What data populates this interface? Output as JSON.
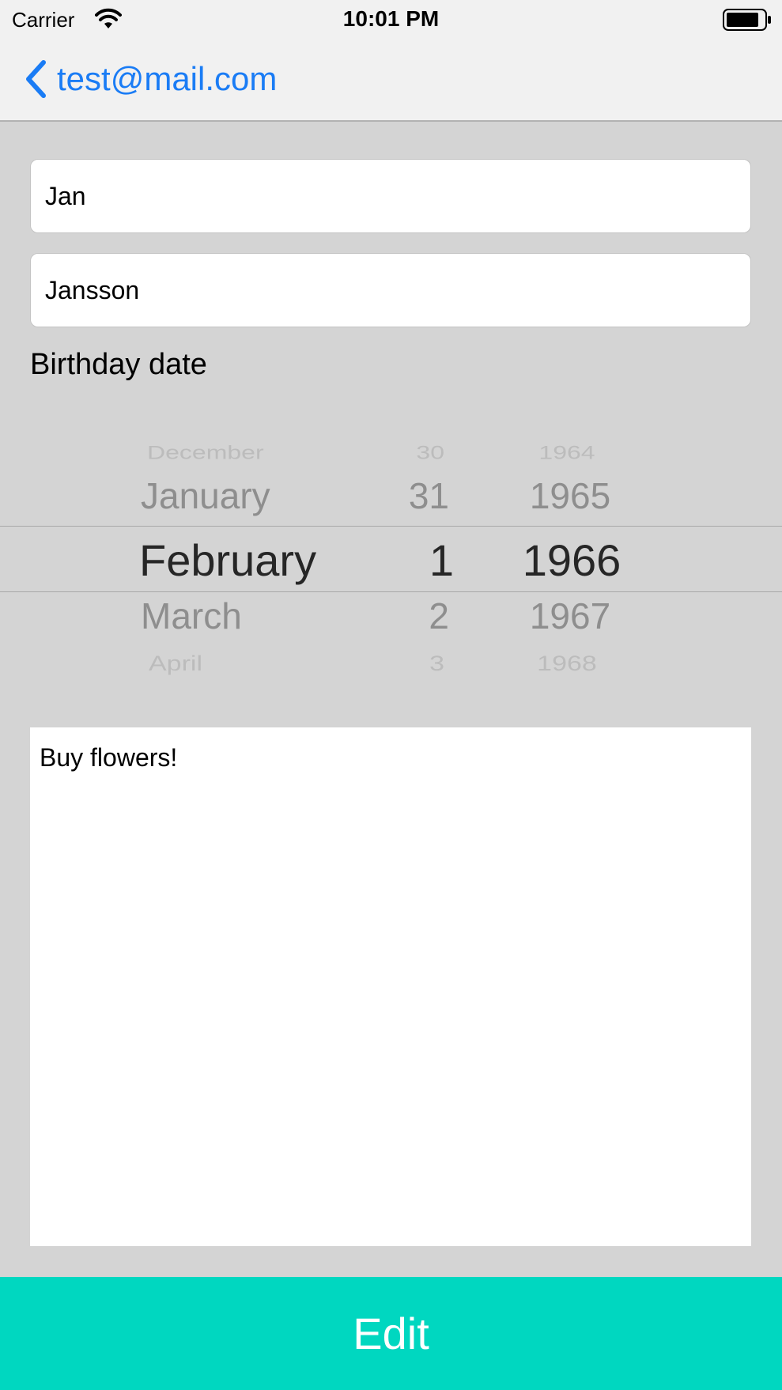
{
  "status_bar": {
    "carrier": "Carrier",
    "time": "10:01 PM"
  },
  "nav": {
    "back_label": "test@mail.com",
    "accent_color": "#1a7cf5"
  },
  "form": {
    "first_name": "Jan",
    "last_name": "Jansson",
    "birthday_label": "Birthday date"
  },
  "date_picker": {
    "months": [
      "December",
      "January",
      "February",
      "March",
      "April"
    ],
    "days": [
      "30",
      "31",
      "1",
      "2",
      "3"
    ],
    "years": [
      "1964",
      "1965",
      "1966",
      "1967",
      "1968"
    ],
    "selected": {
      "month": "February",
      "day": "1",
      "year": "1966"
    }
  },
  "notes": {
    "text": "Buy flowers!"
  },
  "edit_button": {
    "label": "Edit",
    "color": "#00d7c0"
  }
}
